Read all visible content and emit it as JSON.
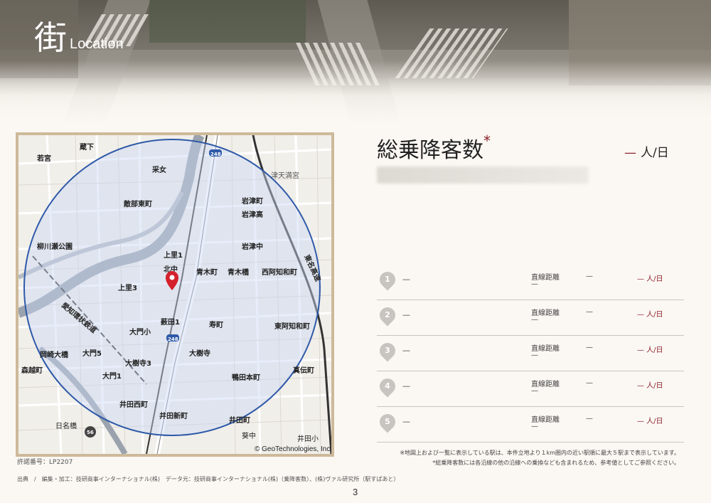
{
  "header": {
    "title_kanji": "街",
    "title_en": "Location"
  },
  "summary": {
    "label": "総乗降客数",
    "asterisk": "*",
    "value_dash": "—",
    "value_unit": "人/日"
  },
  "map": {
    "credit": "© GeoTechnologies, Inc.",
    "labels": [
      "若宮",
      "蔵下",
      "采女",
      "敵部東町",
      "岩津町",
      "岩津高",
      "岩津中",
      "津天満宮",
      "柳川瀬公園",
      "上里1",
      "北中",
      "青木町",
      "青木橋",
      "西阿知和町",
      "上里3",
      "愛知環状鉄道",
      "薮田1",
      "大門小",
      "寿町",
      "東阿知和町",
      "岡崎大橋",
      "大門5",
      "大樹寺3",
      "大樹寺",
      "鴨田本町",
      "真伝町",
      "森越町",
      "大門1",
      "井田西町",
      "井田新町",
      "井田町",
      "葵中",
      "井田小",
      "日名橋",
      "東名高速",
      "248",
      "56"
    ]
  },
  "permit": "許諾番号：LP2207",
  "credit_line": "出典　/　編集・加工：技研商事インターナショナル(株)　データ元：技研商事インターナショナル(株)（乗降客数）、(株)ヴァル研究所（駅すぱあと）",
  "page_number": "3",
  "stations": [
    {
      "num": "1",
      "name": "—",
      "dist_label": "直線距離",
      "dist": "—",
      "line": "—",
      "ppl": "— 人/日"
    },
    {
      "num": "2",
      "name": "—",
      "dist_label": "直線距離",
      "dist": "—",
      "line": "—",
      "ppl": "— 人/日"
    },
    {
      "num": "3",
      "name": "—",
      "dist_label": "直線距離",
      "dist": "—",
      "line": "—",
      "ppl": "— 人/日"
    },
    {
      "num": "4",
      "name": "—",
      "dist_label": "直線距離",
      "dist": "—",
      "line": "—",
      "ppl": "— 人/日"
    },
    {
      "num": "5",
      "name": "—",
      "dist_label": "直線距離",
      "dist": "—",
      "line": "—",
      "ppl": "— 人/日"
    }
  ],
  "notes": [
    "※地図上および一覧に表示している駅は、本件立地より１km圏内の近い駅順に最大５駅まで表示しています。",
    "*総乗降客数には各沿線の他の沿線への乗換なども含まれるため、参考値としてご参照ください。"
  ],
  "colors": {
    "accent": "#8b1e2b",
    "circle": "#2e59a8",
    "pin": "#d4212c"
  }
}
